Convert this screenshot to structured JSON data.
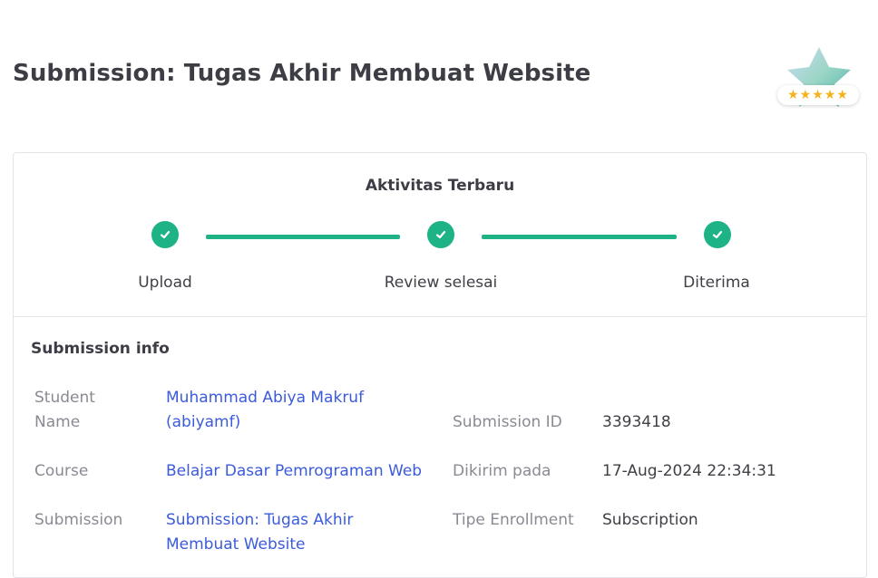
{
  "page": {
    "title": "Submission: Tugas Akhir Membuat Website"
  },
  "badge": {
    "rating_stars": "★★★★★",
    "icon": "star-badge-icon"
  },
  "activity": {
    "title": "Aktivitas Terbaru",
    "steps": [
      {
        "label": "Upload",
        "status": "done"
      },
      {
        "label": "Review selesai",
        "status": "done"
      },
      {
        "label": "Diterima",
        "status": "done"
      }
    ],
    "accent_color": "#1db386"
  },
  "info": {
    "title": "Submission info",
    "student_name_label": "Student Name",
    "student_name_value": "Muhammad Abiya Makruf (abiyamf)",
    "course_label": "Course",
    "course_value": "Belajar Dasar Pemrograman Web",
    "submission_label": "Submission",
    "submission_value": "Submission: Tugas Akhir Membuat Website",
    "submission_id_label": "Submission ID",
    "submission_id_value": "3393418",
    "sent_label": "Dikirim pada",
    "sent_value": "17-Aug-2024 22:34:31",
    "enrollment_label": "Tipe Enrollment",
    "enrollment_value": "Subscription",
    "link_color": "#3b5bdb"
  }
}
